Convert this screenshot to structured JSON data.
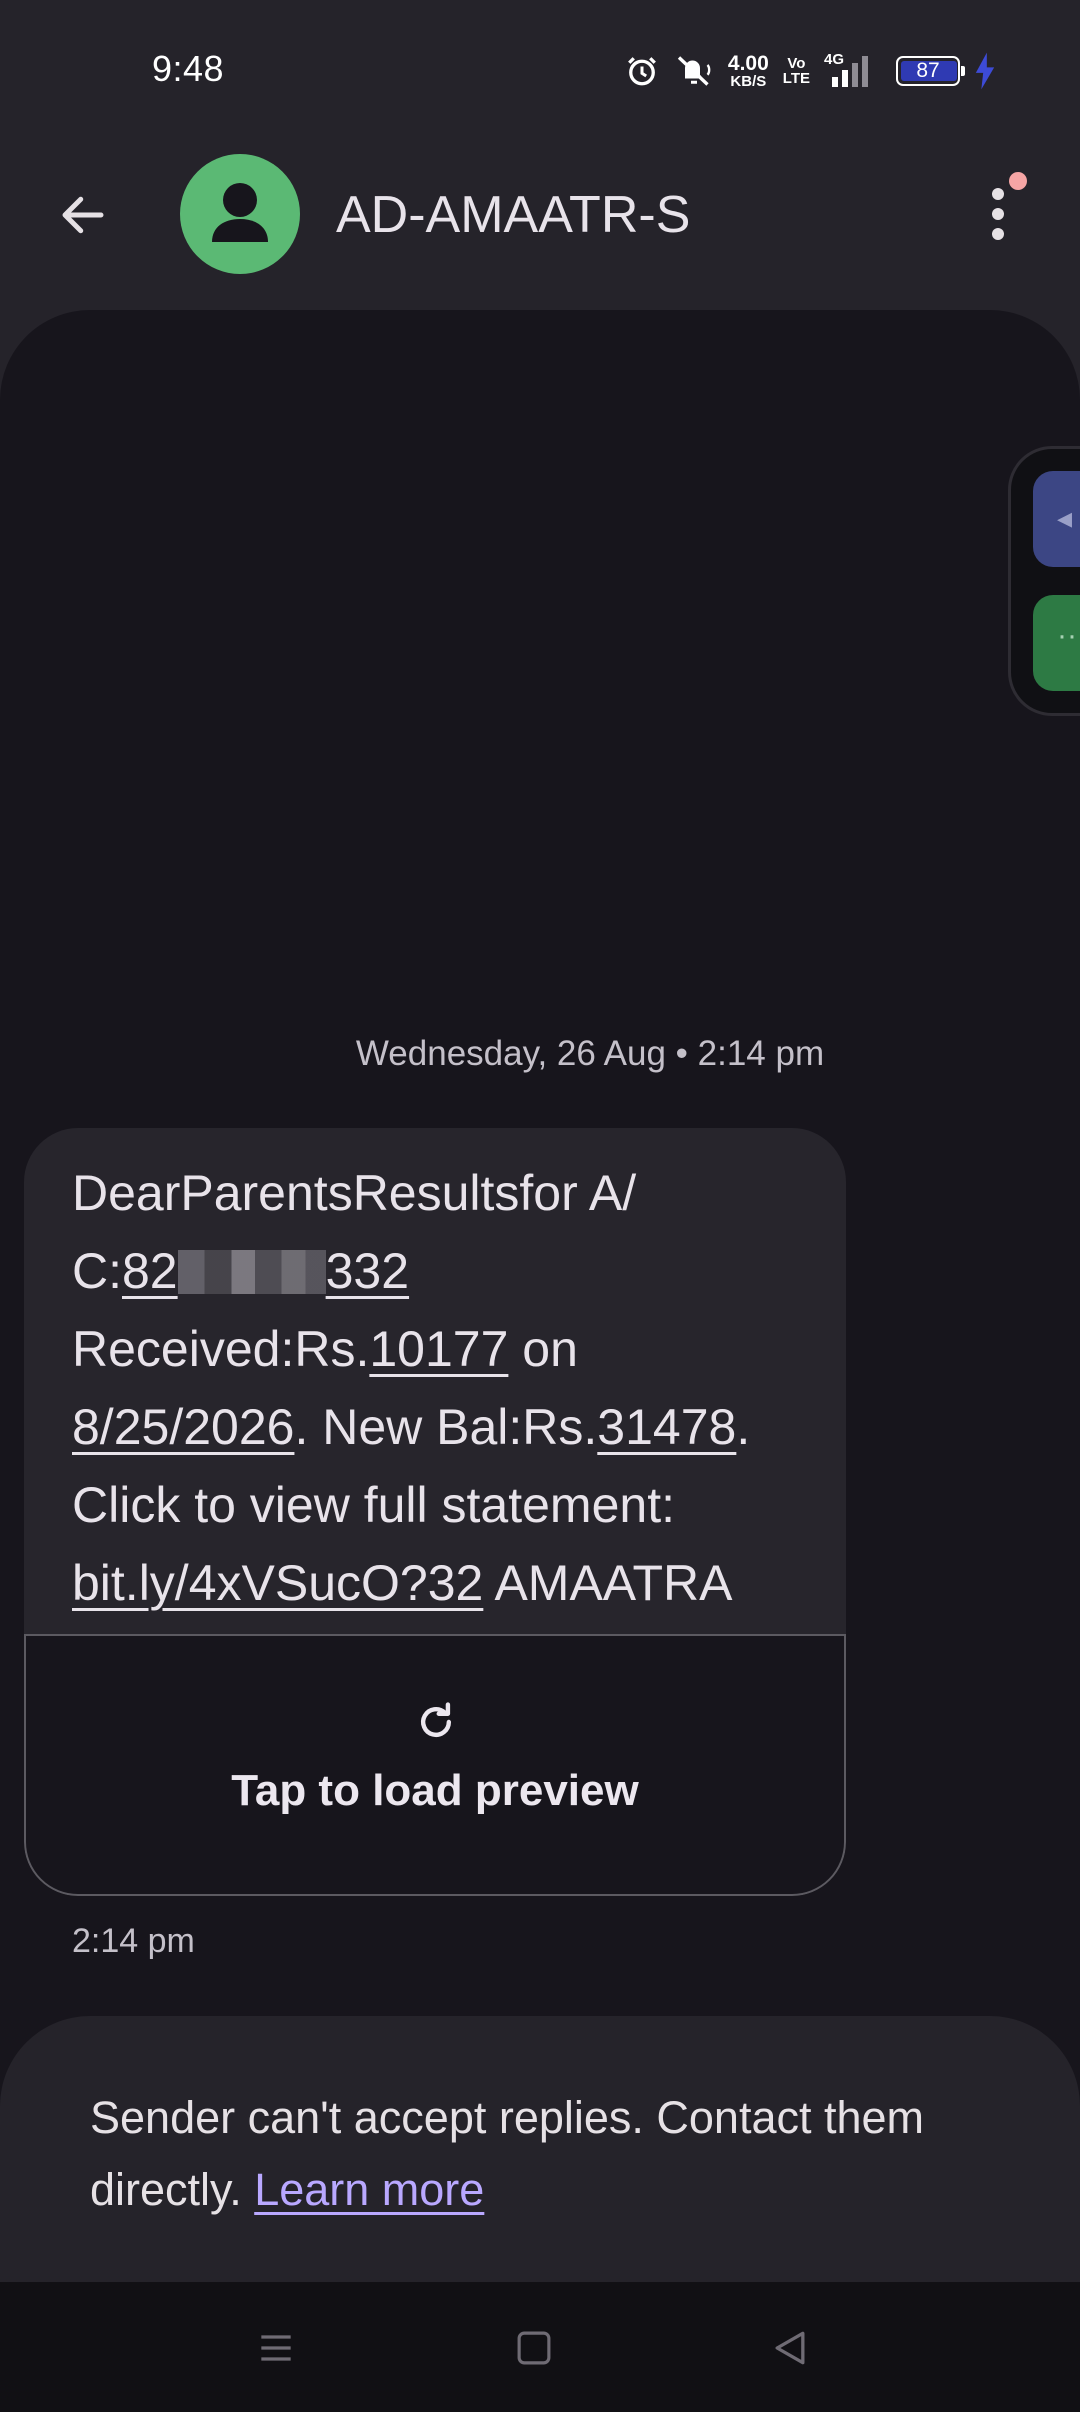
{
  "status_bar": {
    "time": "9:48",
    "net_speed_value": "4.00",
    "net_speed_unit": "KB/S",
    "volte_top": "Vo",
    "volte_bottom": "LTE",
    "network": "4G",
    "battery": "87"
  },
  "header": {
    "contact_name": "AD-AMAATR-S",
    "avatar_color": "#5bb974"
  },
  "conversation": {
    "date_separator": "Wednesday, 26 Aug • 2:14 pm",
    "message": {
      "line1": "DearParentsResultsfor A/",
      "acct_prefix": "C:",
      "acct_start": "82",
      "acct_end": "332",
      "received_label": "Received:Rs.",
      "amount": "10177",
      "on_label": " on",
      "date": "8/25/2026",
      "balance_label": ". New Bal:Rs.",
      "balance": "31478",
      "period": ".",
      "statement_label": "Click to view full statement:",
      "link": "bit.ly/4xVSucO?32",
      "signature": " AMAATRA"
    },
    "preview_label": "Tap to load preview",
    "time": "2:14 pm"
  },
  "reply_bar": {
    "text": "Sender can't accept replies. Contact them directly. ",
    "link": "Learn more"
  }
}
